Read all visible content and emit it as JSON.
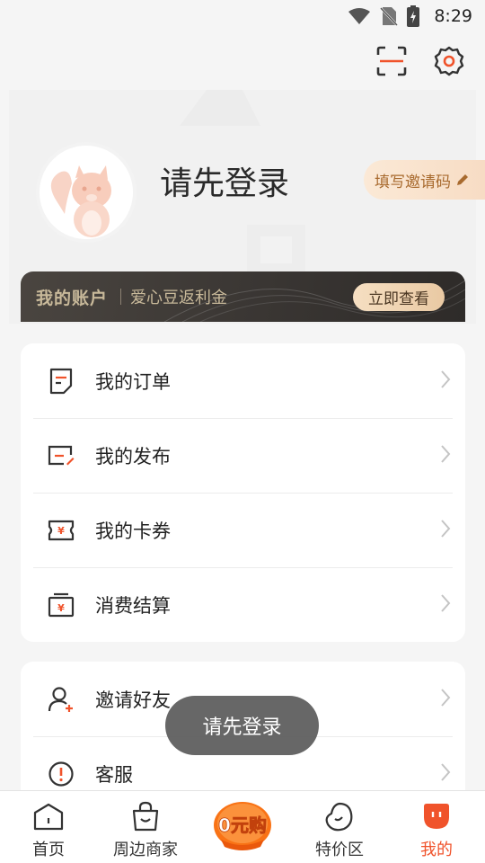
{
  "status_bar": {
    "time": "8:29"
  },
  "top_actions": {
    "scan_icon": "scan-icon",
    "settings_icon": "gear-icon"
  },
  "profile": {
    "title": "请先登录",
    "invite_label": "填写邀请码"
  },
  "account_banner": {
    "title": "我的账户",
    "subtitle": "爱心豆返利金",
    "button": "立即查看"
  },
  "menu_group_1": [
    {
      "label": "我的订单",
      "icon": "order-icon"
    },
    {
      "label": "我的发布",
      "icon": "publish-icon"
    },
    {
      "label": "我的卡券",
      "icon": "coupon-icon"
    },
    {
      "label": "消费结算",
      "icon": "settlement-icon"
    }
  ],
  "menu_group_2": [
    {
      "label": "邀请好友",
      "icon": "invite-friend-icon"
    },
    {
      "label": "客服",
      "icon": "customer-service-icon"
    }
  ],
  "toast": "请先登录",
  "bottom_nav": [
    {
      "label": "首页",
      "icon": "home-icon",
      "active": false
    },
    {
      "label": "周边商家",
      "icon": "shopping-bag-icon",
      "active": false
    },
    {
      "label": "0元购",
      "icon": "zero-yuan-badge",
      "active": false
    },
    {
      "label": "特价区",
      "icon": "bean-icon",
      "active": false
    },
    {
      "label": "我的",
      "icon": "profile-icon",
      "active": true
    }
  ],
  "colors": {
    "accent": "#f0532b",
    "gold": "#c8b99a",
    "banner_dark": "#3b3734"
  }
}
